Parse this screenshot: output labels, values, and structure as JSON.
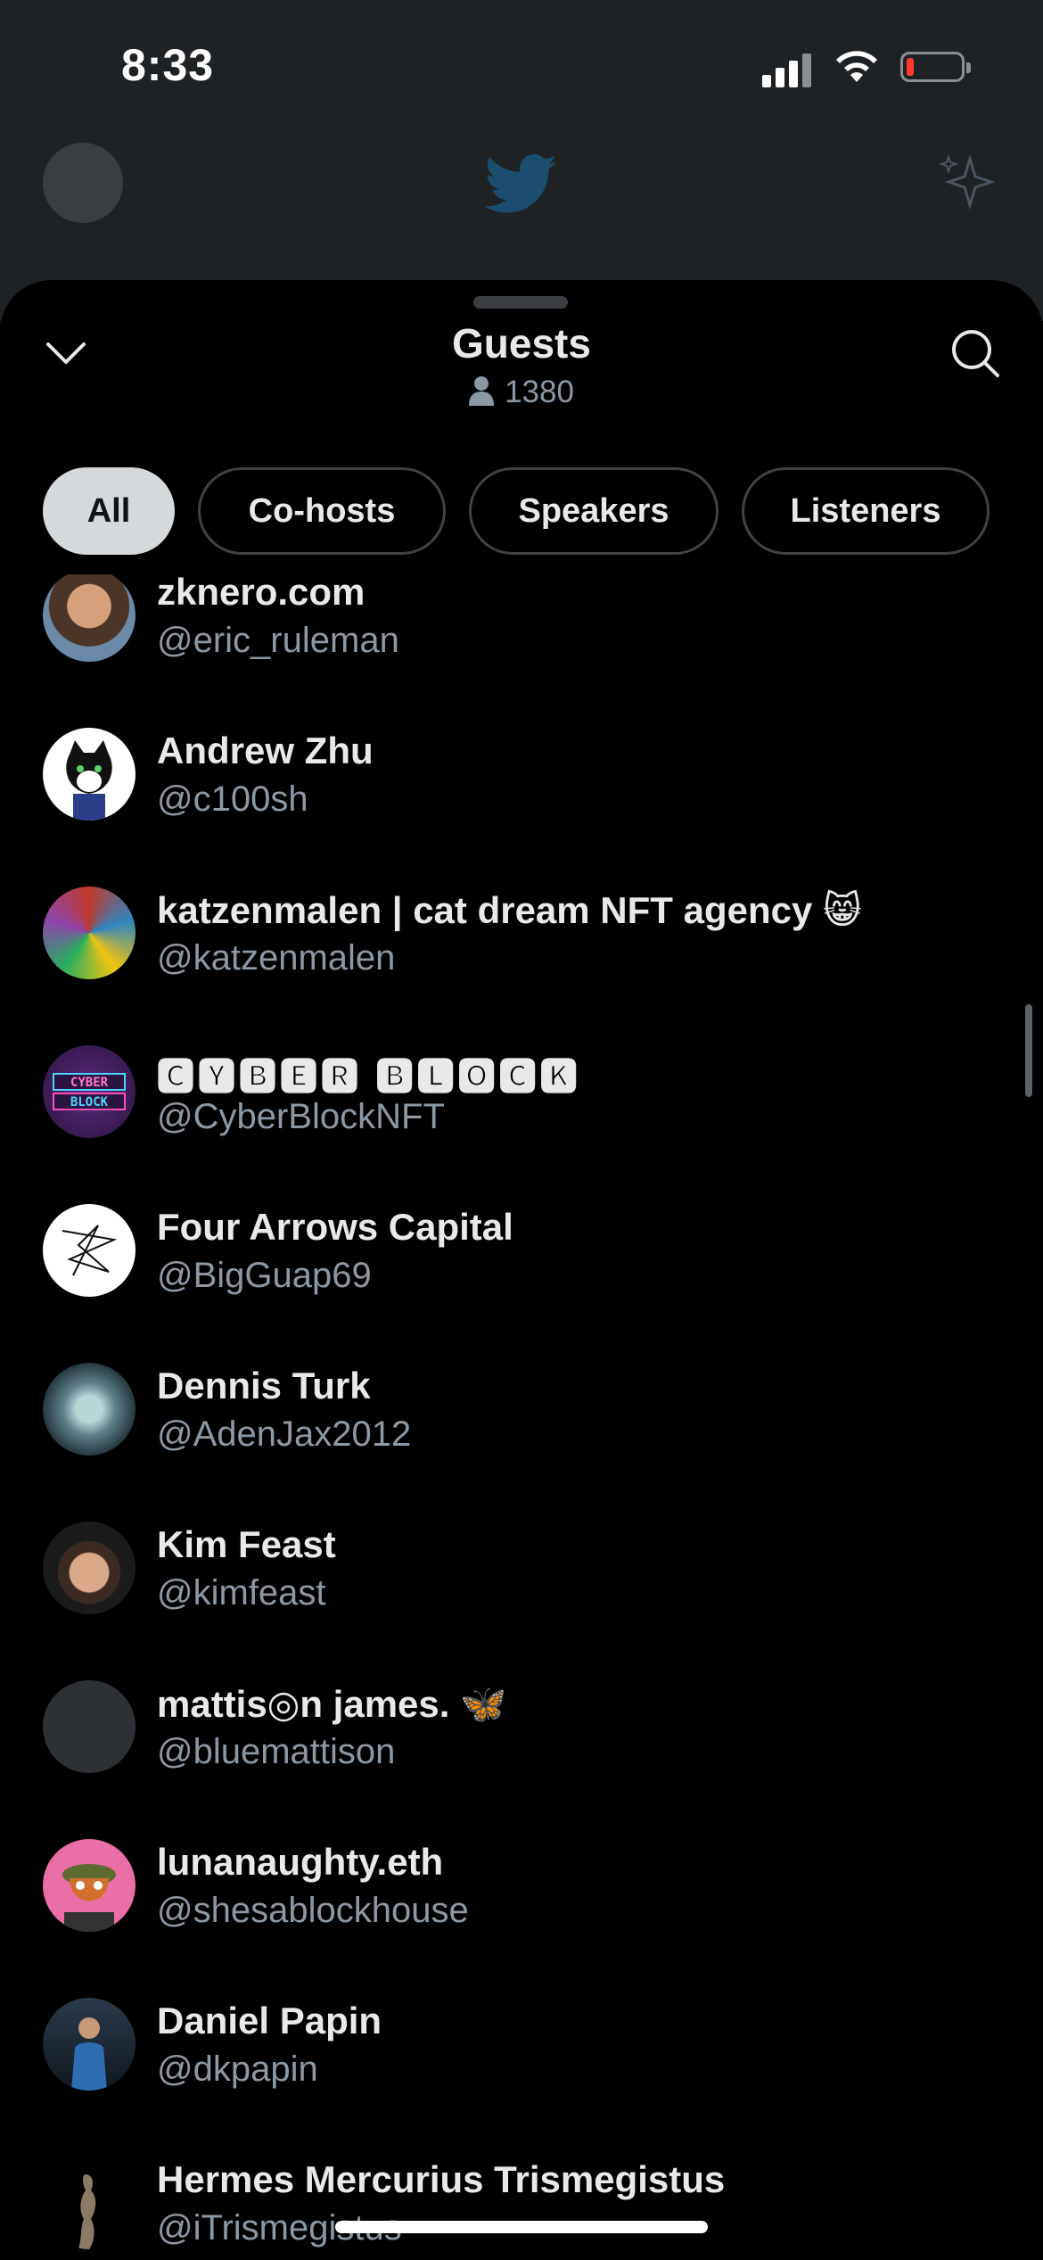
{
  "status_bar": {
    "time": "8:33"
  },
  "sheet": {
    "title": "Guests",
    "listener_count": "1380"
  },
  "tabs": [
    {
      "label": "All",
      "active": true
    },
    {
      "label": "Co-hosts",
      "active": false
    },
    {
      "label": "Speakers",
      "active": false
    },
    {
      "label": "Listeners",
      "active": false
    }
  ],
  "guests": [
    {
      "name": "zknero.com",
      "handle": "@eric_ruleman"
    },
    {
      "name": "Andrew Zhu",
      "handle": "@c100sh"
    },
    {
      "name": "katzenmalen | cat dream NFT agency 😸",
      "handle": "@katzenmalen"
    },
    {
      "name": "🅲🆈🅱🅴🆁 🅱🅻🅾🅲🅺",
      "handle": "@CyberBlockNFT"
    },
    {
      "name": "Four Arrows Capital",
      "handle": "@BigGuap69"
    },
    {
      "name": "Dennis Turk",
      "handle": "@AdenJax2012"
    },
    {
      "name": "Kim Feast",
      "handle": "@kimfeast"
    },
    {
      "name": "mattis◎n james. 🦋",
      "handle": "@bluemattison"
    },
    {
      "name": "lunanaughty.eth",
      "handle": "@shesablockhouse"
    },
    {
      "name": "Daniel Papin",
      "handle": "@dkpapin"
    },
    {
      "name": "Hermes Mercurius Trismegistus",
      "handle": "@iTrismegistus"
    }
  ],
  "colors": {
    "background": "#000000",
    "text_primary": "#e7e9ea",
    "text_secondary": "#8b98a5",
    "tab_active_bg": "#d6d9db",
    "tab_border": "#3e4347"
  },
  "icons": [
    "chevron-down-icon",
    "search-icon",
    "person-icon",
    "twitter-bird-icon",
    "sparkle-icon"
  ]
}
